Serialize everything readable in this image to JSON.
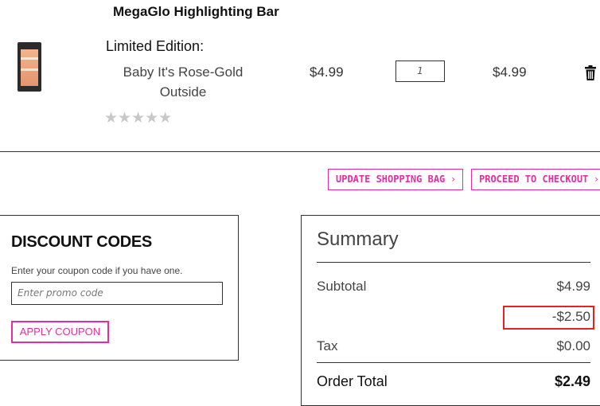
{
  "product": {
    "name": "MegaGlo Highlighting Bar",
    "edition": "Limited Edition:",
    "variant_line1": "Baby It's Rose-Gold",
    "variant_line2": "Outside",
    "rating_stars": "★★★★★",
    "rating_value": 0,
    "price": "$4.99",
    "quantity": "1",
    "line_total": "$4.99"
  },
  "actions": {
    "update_label": "UPDATE SHOPPING BAG",
    "checkout_label": "PROCEED TO CHECKOUT",
    "chevron": "›"
  },
  "discount": {
    "title": "DISCOUNT CODES",
    "hint": "Enter your coupon code if you have one.",
    "input_placeholder": "Enter promo code",
    "apply_label": "APPLY COUPON"
  },
  "summary": {
    "title": "Summary",
    "subtotal_label": "Subtotal",
    "subtotal_value": "$4.99",
    "discount_value": "-$2.50",
    "tax_label": "Tax",
    "tax_value": "$0.00",
    "order_total_label": "Order Total",
    "order_total_value": "$2.49"
  },
  "colors": {
    "accent": "#e22ea1",
    "highlight": "#e02424",
    "star_empty": "#c8c8c8"
  },
  "icons": {
    "delete": "trash-icon",
    "chevron": "chevron-right-icon"
  }
}
